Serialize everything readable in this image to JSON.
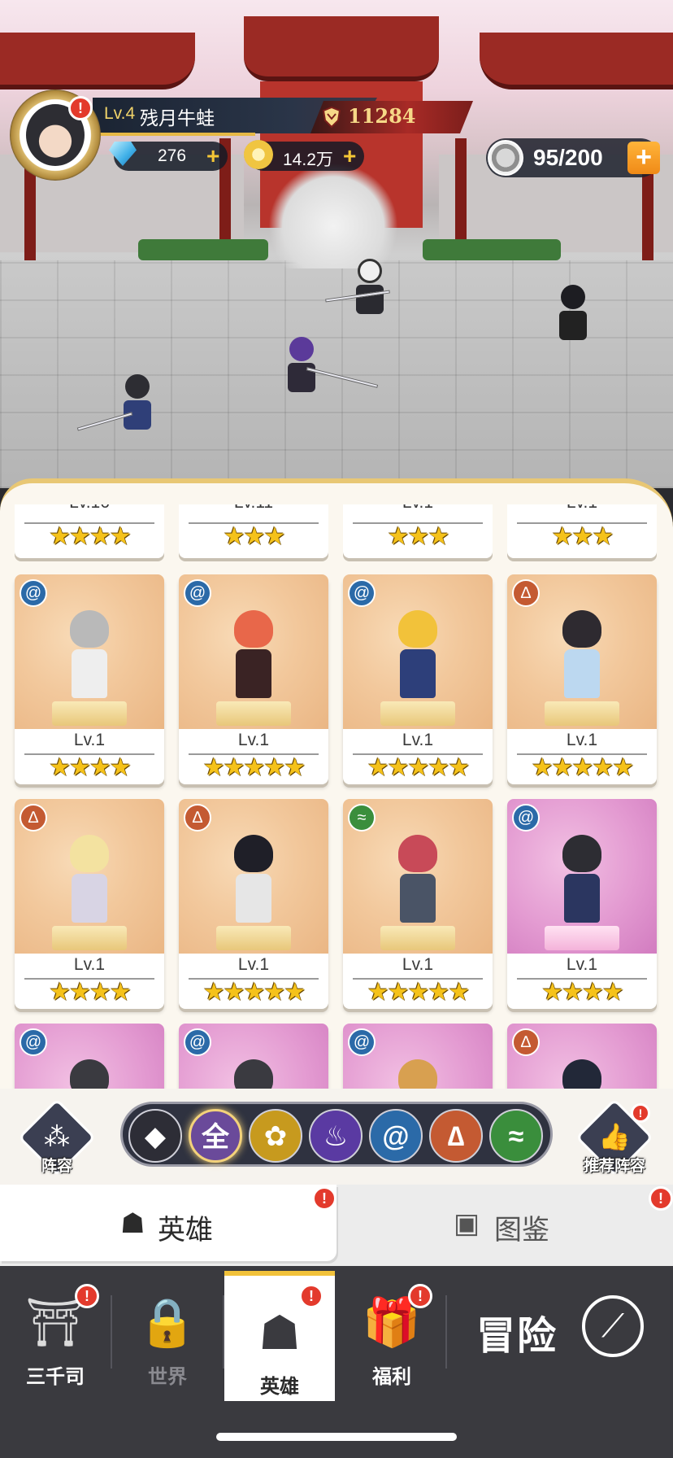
{
  "player": {
    "level": "Lv.4",
    "name": "残月牛蛙",
    "power": "11284",
    "gems": "276",
    "gold": "14.2万",
    "stamina": "95/200"
  },
  "partial_row": [
    {
      "level": "Lv.16",
      "stars": "★★★★"
    },
    {
      "level": "Lv.11",
      "stars": "★★★"
    },
    {
      "level": "Lv.1",
      "stars": "★★★"
    },
    {
      "level": "Lv.1",
      "stars": "★★★"
    }
  ],
  "heroes": [
    {
      "level": "Lv.1",
      "stars": "★★★★",
      "element": "water",
      "element_icon": "@",
      "theme": "orange",
      "hair": "#b9b9b9",
      "outfit": "#eeeeee"
    },
    {
      "level": "Lv.1",
      "stars": "★★★★★",
      "element": "water",
      "element_icon": "@",
      "theme": "orange",
      "hair": "#e8674a",
      "outfit": "#3a2324"
    },
    {
      "level": "Lv.1",
      "stars": "★★★★★",
      "element": "water",
      "element_icon": "@",
      "theme": "orange",
      "hair": "#f2c23a",
      "outfit": "#2d3f7a"
    },
    {
      "level": "Lv.1",
      "stars": "★★★★★",
      "element": "fire",
      "element_icon": "∆",
      "theme": "orange",
      "hair": "#2e2a30",
      "outfit": "#bcd8f0"
    },
    {
      "level": "Lv.1",
      "stars": "★★★★",
      "element": "fire",
      "element_icon": "∆",
      "theme": "orange",
      "hair": "#f3e2a0",
      "outfit": "#d8d4e4"
    },
    {
      "level": "Lv.1",
      "stars": "★★★★★",
      "element": "fire",
      "element_icon": "∆",
      "theme": "orange",
      "hair": "#1f1f28",
      "outfit": "#e6e6e6"
    },
    {
      "level": "Lv.1",
      "stars": "★★★★★",
      "element": "life",
      "element_icon": "≈",
      "theme": "orange",
      "hair": "#c84a58",
      "outfit": "#4a5466"
    },
    {
      "level": "Lv.1",
      "stars": "★★★★",
      "element": "water",
      "element_icon": "@",
      "theme": "pink",
      "hair": "#2d2d33",
      "outfit": "#2b3660"
    }
  ],
  "peek_row": [
    {
      "element": "water",
      "element_icon": "@",
      "hair": "#3a3a40"
    },
    {
      "element": "water",
      "element_icon": "@",
      "hair": "#3a3a40"
    },
    {
      "element": "water",
      "element_icon": "@",
      "hair": "#d8a050"
    },
    {
      "element": "fire",
      "element_icon": "∆",
      "hair": "#222838"
    }
  ],
  "filter": {
    "lineup_label": "阵容",
    "all_label": "全",
    "recommend_label": "推荐阵容",
    "options": [
      {
        "name": "type-filter",
        "glyph": "◆",
        "color": "#2d2d36"
      },
      {
        "name": "all-filter",
        "glyph": "全",
        "color": "#6a4a9a"
      },
      {
        "name": "lotus-filter",
        "glyph": "✿",
        "color": "#c79a1e"
      },
      {
        "name": "shadow-flame-filter",
        "glyph": "♨",
        "color": "#5a3aa2"
      },
      {
        "name": "water-filter",
        "glyph": "@",
        "color": "#2b6aa8"
      },
      {
        "name": "fire-meditate-filter",
        "glyph": "∆",
        "color": "#c45a32"
      },
      {
        "name": "life-dna-filter",
        "glyph": "≈",
        "color": "#3a8e3c"
      }
    ]
  },
  "subtabs": {
    "heroes": "英雄",
    "codex": "图鉴"
  },
  "nav": {
    "items": [
      {
        "label": "三千司",
        "glyph": "⛩"
      },
      {
        "label": "世界",
        "glyph": "🔒"
      },
      {
        "label": "英雄",
        "glyph": "☗"
      },
      {
        "label": "福利",
        "glyph": "🎁"
      }
    ],
    "adventure": "冒险"
  },
  "alert_mark": "!"
}
